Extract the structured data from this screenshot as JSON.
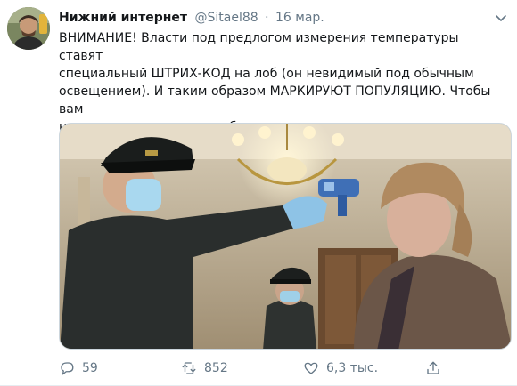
{
  "tweet": {
    "author_name": "Нижний интернет",
    "handle": "@Sitael88",
    "separator": "·",
    "date": "16 мар.",
    "text": "ВНИМАНИЕ! Власти под предлогом измерения температуры ставят\nспециальный ШТРИХ-КОД на лоб (он невидимый под обычным\nосвещением). И таким образом МАРКИРУЮТ ПОПУЛЯЦИЮ. Чтобы вам\nне поставили штрихкод обязательно перед выходом из дома мажьте\nлоб ГОВНОМ. Будьте бдительны!",
    "replies": "59",
    "retweets": "852",
    "likes": "6,3 тыс."
  },
  "icons": {
    "more": "chevron-down-icon",
    "reply": "reply-icon",
    "retweet": "retweet-icon",
    "like": "heart-icon",
    "share": "share-icon"
  },
  "colors": {
    "text_primary": "#14171a",
    "text_secondary": "#657786",
    "border": "#e6ecf0"
  }
}
